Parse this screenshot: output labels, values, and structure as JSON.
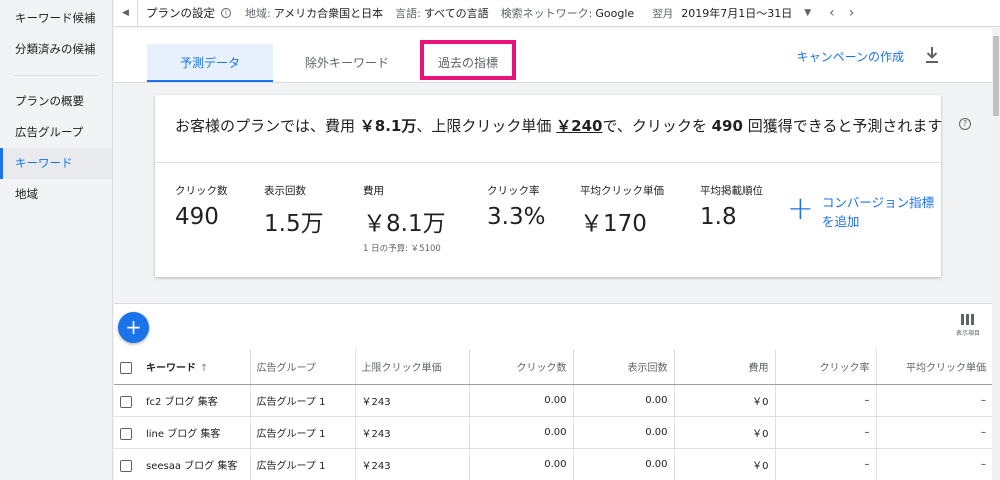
{
  "sidebar": {
    "items": [
      {
        "label": "キーワード候補"
      },
      {
        "label": "分類済みの候補"
      },
      {
        "label": "プランの概要"
      },
      {
        "label": "広告グループ"
      },
      {
        "label": "キーワード",
        "active": true
      },
      {
        "label": "地域"
      }
    ]
  },
  "topbar": {
    "plan_title": "プランの設定",
    "location_label": "地域:",
    "location_value": "アメリカ合衆国と日本",
    "language_label": "言語:",
    "language_value": "すべての言語",
    "network_label": "検索ネットワーク:",
    "network_value": "Google",
    "period_label": "翌月",
    "period_value": "2019年7月1日〜31日"
  },
  "tabs": [
    {
      "label": "予測データ",
      "active": true
    },
    {
      "label": "除外キーワード"
    },
    {
      "label": "過去の指標",
      "highlighted": true
    }
  ],
  "create_campaign_label": "キャンペーンの作成",
  "forecast": {
    "headline_1": "お客様のプランでは、費用 ",
    "cost": "￥8.1万",
    "headline_2": "、上限クリック単価 ",
    "max_cpc": "￥240",
    "headline_3": "で、クリックを ",
    "clicks": "490",
    "headline_4": " 回獲得できると予測されます",
    "metrics": [
      {
        "label": "クリック数",
        "value": "490"
      },
      {
        "label": "表示回数",
        "value": "1.5万"
      },
      {
        "label": "費用",
        "value": "￥8.1万",
        "sub": "1 日の予算: ￥5100"
      },
      {
        "label": "クリック率",
        "value": "3.3%"
      },
      {
        "label": "平均クリック単価",
        "value": "￥170"
      },
      {
        "label": "平均掲載順位",
        "value": "1.8"
      }
    ],
    "add_conversion_line1": "コンバージョン指標",
    "add_conversion_line2": "を追加"
  },
  "columns_button_label": "表示項目",
  "table": {
    "headers": [
      "キーワード",
      "広告グループ",
      "上限クリック単価",
      "クリック数",
      "表示回数",
      "費用",
      "クリック率",
      "平均クリック単価"
    ],
    "rows": [
      [
        "fc2 ブログ 集客",
        "広告グループ 1",
        "￥243",
        "0.00",
        "0.00",
        "￥0",
        "–",
        "–"
      ],
      [
        "line ブログ 集客",
        "広告グループ 1",
        "￥243",
        "0.00",
        "0.00",
        "￥0",
        "–",
        "–"
      ],
      [
        "seesaa ブログ 集客",
        "広告グループ 1",
        "￥243",
        "0.00",
        "0.00",
        "￥0",
        "–",
        "–"
      ]
    ]
  },
  "colors": {
    "accent": "#1a73e8",
    "highlight_box": "#e8127a"
  }
}
